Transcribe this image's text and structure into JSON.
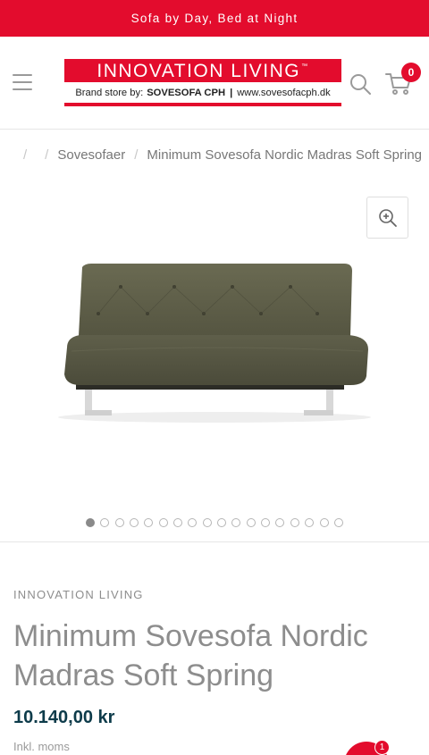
{
  "announcement": "Sofa by Day, Bed at Night",
  "header": {
    "logo": {
      "brand_name": "INNOVATION LIVING",
      "trademark": "™",
      "store_prefix": "Brand store by:",
      "store_name": "SOVESOFA CPH",
      "separator": "|",
      "website": "www.sovesofacph.dk"
    },
    "cart_count": "0",
    "icons": {
      "menu": "hamburger-menu-icon",
      "search": "search-icon",
      "cart": "cart-icon"
    }
  },
  "breadcrumb": {
    "separators": [
      "/",
      "/",
      "/"
    ],
    "category": "Sovesofaer",
    "current": "Minimum Sovesofa Nordic Madras Soft Spring"
  },
  "gallery": {
    "image_count": 18,
    "active_index": 0,
    "zoom_icon": "zoom-in-icon",
    "sofa_color": "#5b5a45"
  },
  "product": {
    "brand": "INNOVATION LIVING",
    "title": "Minimum Sovesofa Nordic Madras Soft Spring",
    "price": "10.140,00 kr",
    "tax_note": "Inkl. moms"
  },
  "chat": {
    "badge_count": "1",
    "icon": "chat-icon"
  },
  "colors": {
    "accent": "#e30c2d",
    "price": "#0d3b4a",
    "muted_text": "#8d8d8d"
  }
}
